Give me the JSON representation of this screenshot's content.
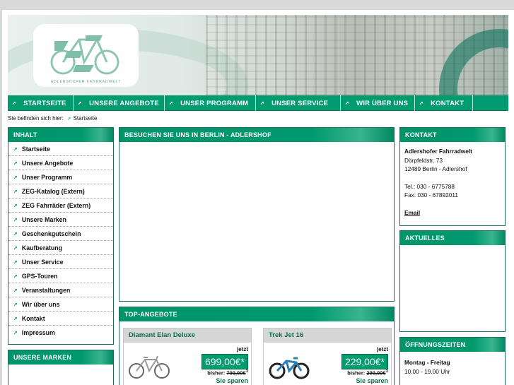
{
  "header": {
    "logo_text": "ADLERSHOFER FAHRRADWELT"
  },
  "nav": {
    "items": [
      {
        "label": "STARTSEITE"
      },
      {
        "label": "UNSERE ANGEBOTE"
      },
      {
        "label": "UNSER PROGRAMM"
      },
      {
        "label": "UNSER SERVICE"
      },
      {
        "label": "WIR ÜBER UNS"
      },
      {
        "label": "KONTAKT"
      }
    ]
  },
  "breadcrumb": {
    "prefix": "Sie befinden sich hier:",
    "current": "Startseite"
  },
  "sidebar": {
    "title": "INHALT",
    "items": [
      {
        "label": "Startseite"
      },
      {
        "label": "Unsere Angebote"
      },
      {
        "label": "Unser Programm"
      },
      {
        "label": "ZEG-Katalog (Extern)"
      },
      {
        "label": "ZEG Fahrräder (Extern)"
      },
      {
        "label": "Unsere Marken"
      },
      {
        "label": "Geschenkgutschein"
      },
      {
        "label": "Kaufberatung"
      },
      {
        "label": "Unser Service"
      },
      {
        "label": "GPS-Touren"
      },
      {
        "label": "Veranstaltungen"
      },
      {
        "label": "Wir über uns"
      },
      {
        "label": "Kontakt"
      },
      {
        "label": "Impressum"
      }
    ],
    "marken_title": "UNSERE MARKEN"
  },
  "main": {
    "visit_title": "BESUCHEN SIE UNS IN BERLIN - ADLERSHOF",
    "top_title": "TOP-ANGEBOTE",
    "products": [
      {
        "name": "Diamant Elan Deluxe",
        "jetzt": "jetzt",
        "price": "699,00€*",
        "bisher_label": "bisher:",
        "bisher_price": "799,00€",
        "bisher_sup": "1",
        "sparen": "Sie sparen"
      },
      {
        "name": "Trek Jet 16",
        "jetzt": "jetzt",
        "price": "229,00€*",
        "bisher_label": "bisher:",
        "bisher_price": "299,00€",
        "bisher_sup": "1",
        "sparen": "Sie sparen"
      }
    ]
  },
  "right": {
    "kontakt_title": "KONTAKT",
    "company": "Adlershofer Fahrradwelt",
    "street": "Dörpfeldstr. 73",
    "city": "12489 Berlin - Adlershof",
    "tel": "Tel.: 030 - 6775788",
    "fax": "Fax: 030 - 67892011",
    "email": "Email",
    "aktuelles_title": "AKTUELLES",
    "hours_title": "ÖFFNUNGSZEITEN",
    "hours_days": "Montag - Freitag",
    "hours_time": "10.00 - 19.00 Uhr"
  },
  "colors": {
    "brand_green": "#009b6f",
    "dark_green": "#0b6e4f"
  }
}
